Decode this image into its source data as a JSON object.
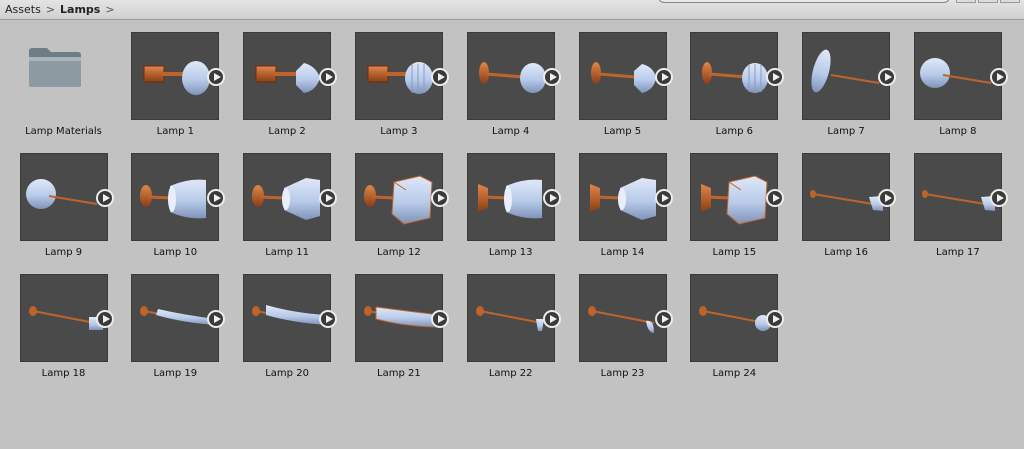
{
  "breadcrumb": {
    "root": "Assets",
    "current": "Lamps",
    "separator": ">"
  },
  "items": [
    {
      "name": "Lamp Materials",
      "kind": "folder"
    },
    {
      "name": "Lamp 1",
      "kind": "prefab"
    },
    {
      "name": "Lamp 2",
      "kind": "prefab"
    },
    {
      "name": "Lamp 3",
      "kind": "prefab"
    },
    {
      "name": "Lamp 4",
      "kind": "prefab"
    },
    {
      "name": "Lamp 5",
      "kind": "prefab"
    },
    {
      "name": "Lamp 6",
      "kind": "prefab"
    },
    {
      "name": "Lamp 7",
      "kind": "prefab"
    },
    {
      "name": "Lamp 8",
      "kind": "prefab"
    },
    {
      "name": "Lamp 9",
      "kind": "prefab"
    },
    {
      "name": "Lamp 10",
      "kind": "prefab"
    },
    {
      "name": "Lamp 11",
      "kind": "prefab"
    },
    {
      "name": "Lamp 12",
      "kind": "prefab"
    },
    {
      "name": "Lamp 13",
      "kind": "prefab"
    },
    {
      "name": "Lamp 14",
      "kind": "prefab"
    },
    {
      "name": "Lamp 15",
      "kind": "prefab"
    },
    {
      "name": "Lamp 16",
      "kind": "prefab"
    },
    {
      "name": "Lamp 17",
      "kind": "prefab"
    },
    {
      "name": "Lamp 18",
      "kind": "prefab"
    },
    {
      "name": "Lamp 19",
      "kind": "prefab"
    },
    {
      "name": "Lamp 20",
      "kind": "prefab"
    },
    {
      "name": "Lamp 21",
      "kind": "prefab"
    },
    {
      "name": "Lamp 22",
      "kind": "prefab"
    },
    {
      "name": "Lamp 23",
      "kind": "prefab"
    },
    {
      "name": "Lamp 24",
      "kind": "prefab"
    }
  ],
  "colors": {
    "background": "#c2c2c2",
    "thumb": "#4a4a4a",
    "metal": "#c0632a",
    "shade": "#b8cbea"
  }
}
